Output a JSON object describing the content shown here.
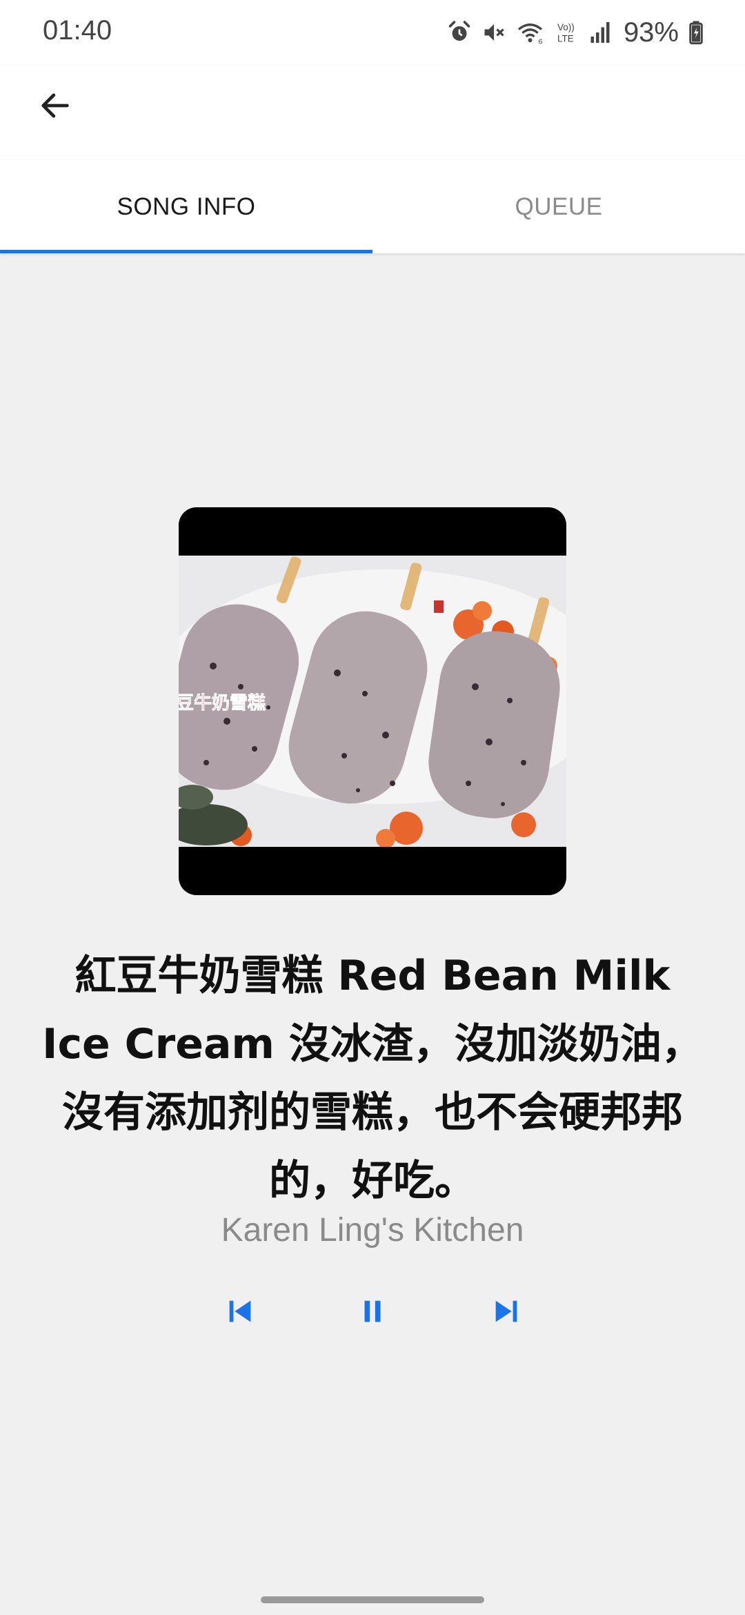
{
  "status_bar": {
    "time": "01:40",
    "battery": "93%",
    "icons": [
      "alarm-icon",
      "mute-icon",
      "wifi-icon",
      "volte-icon",
      "signal-icon",
      "battery-icon"
    ],
    "volte_text": "Vo)) LTE"
  },
  "app_bar": {
    "back_icon": "arrow-left-icon"
  },
  "tabs": [
    {
      "label": "SONG INFO",
      "active": true
    },
    {
      "label": "QUEUE",
      "active": false
    }
  ],
  "now_playing": {
    "title": "紅豆牛奶雪糕 Red Bean Milk Ice Cream 沒冰渣，沒加淡奶油，沒有添加剂的雪糕，也不会硬邦邦的，好吃。",
    "artist": "Karen Ling's Kitchen",
    "album_art_caption": "豆牛奶雪糕"
  },
  "controls": {
    "previous_icon": "skip-previous-icon",
    "pause_icon": "pause-icon",
    "next_icon": "skip-next-icon"
  },
  "colors": {
    "accent": "#1a73e8",
    "background": "#f0f0f1",
    "surface": "#ffffff",
    "text_primary": "#111111",
    "text_secondary": "#8a8a8a"
  }
}
